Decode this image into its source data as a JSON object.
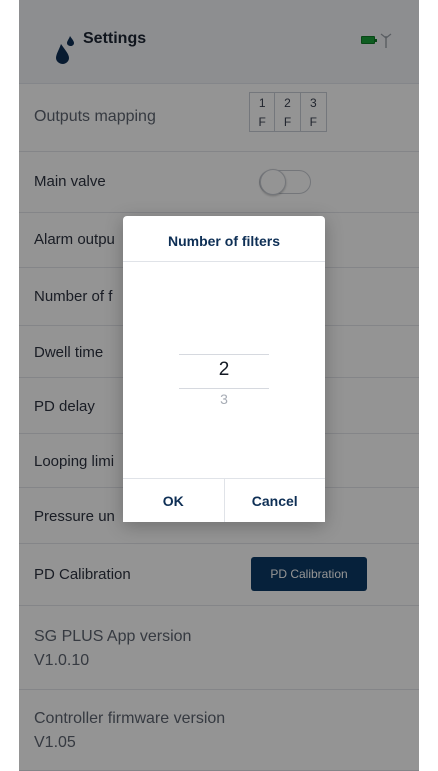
{
  "header": {
    "title": "Settings",
    "icons": {
      "app": "water-drop-icon",
      "battery": "battery-icon",
      "signal": "antenna-icon"
    },
    "colors": {
      "accent": "#0b3a66",
      "battery": "#19a03a"
    }
  },
  "settings": {
    "outputs_mapping": {
      "label": "Outputs mapping",
      "outputs": [
        {
          "number": "1",
          "value": "F"
        },
        {
          "number": "2",
          "value": "F"
        },
        {
          "number": "3",
          "value": "F"
        }
      ]
    },
    "main_valve": {
      "label": "Main valve"
    },
    "alarm_output": {
      "label": "Alarm outpu"
    },
    "number_of_filters": {
      "label": "Number of f"
    },
    "dwell_time": {
      "label": "Dwell time"
    },
    "pd_delay": {
      "label": "PD delay"
    },
    "looping_limit": {
      "label": "Looping limi"
    },
    "pressure_units": {
      "label": "Pressure un"
    },
    "pd_calibration": {
      "label": "PD Calibration",
      "button_label": "PD Calibration"
    },
    "app_version": {
      "label": "SG PLUS App version",
      "value": "V1.0.10"
    },
    "firmware_version": {
      "label": "Controller firmware version",
      "value": "V1.05"
    }
  },
  "dialog": {
    "title": "Number of filters",
    "selected_value": "2",
    "next_value": "3",
    "ok_label": "OK",
    "cancel_label": "Cancel"
  }
}
